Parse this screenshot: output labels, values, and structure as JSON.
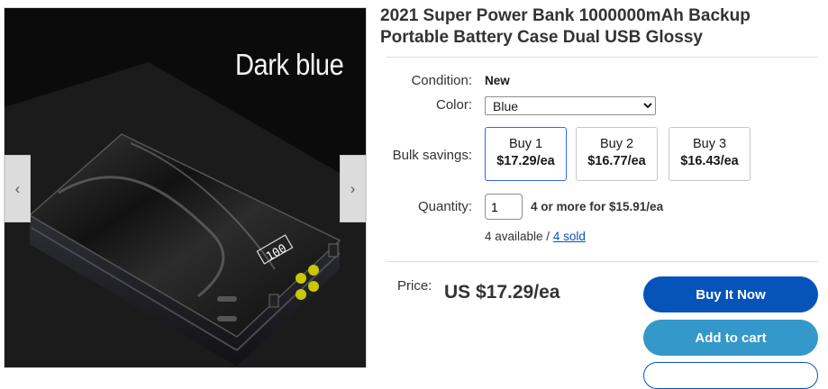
{
  "gallery": {
    "caption": "Dark blue",
    "prev_icon": "chevron-left-icon",
    "next_icon": "chevron-right-icon",
    "display_readout": "100"
  },
  "listing": {
    "title": "2021 Super Power Bank 1000000mAh Backup Portable Battery Case Dual USB Glossy",
    "condition_label": "Condition:",
    "condition_value": "New",
    "color_label": "Color:",
    "color_selected": "Blue",
    "bulk_label": "Bulk savings:",
    "bulk_options": [
      {
        "line1": "Buy 1",
        "line2": "$17.29/ea",
        "selected": true
      },
      {
        "line1": "Buy 2",
        "line2": "$16.77/ea",
        "selected": false
      },
      {
        "line1": "Buy 3",
        "line2": "$16.43/ea",
        "selected": false
      }
    ],
    "quantity_label": "Quantity:",
    "quantity_value": "1",
    "quantity_note": "4 or more for $15.91/ea",
    "available_text": "4 available / ",
    "sold_link": "4 sold",
    "price_label": "Price:",
    "price_value": "US $17.29/ea"
  },
  "actions": {
    "buy_now": "Buy It Now",
    "add_to_cart": "Add to cart"
  },
  "colors": {
    "primary_blue": "#0654ba",
    "cart_blue": "#3498ca",
    "selected_border": "#3665f3"
  }
}
